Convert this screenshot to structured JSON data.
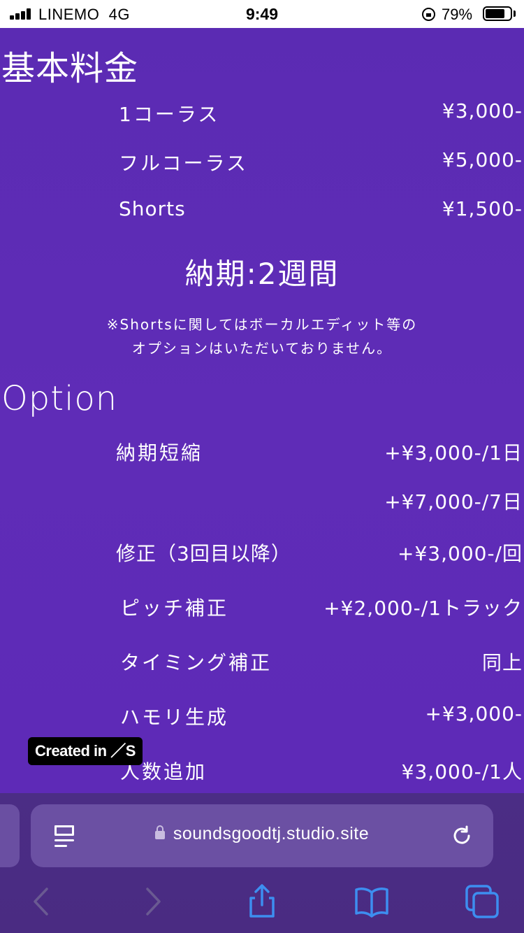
{
  "status_bar": {
    "carrier": "LINEMO",
    "network": "4G",
    "time": "9:49",
    "battery_pct": "79%",
    "battery_level": 0.79
  },
  "sections": {
    "basic": {
      "title": "基本料金",
      "items": [
        {
          "label": "1コーラス",
          "price": "¥3,000-"
        },
        {
          "label": "フルコーラス",
          "price": "¥5,000-"
        },
        {
          "label": "Shorts",
          "price": "¥1,500-"
        }
      ],
      "delivery": "納期:2週間",
      "note_line1": "※Shortsに関してはボーカルエディット等の",
      "note_line2": "オプションはいただいておりません。"
    },
    "option": {
      "title": "Option",
      "items": [
        {
          "label": "納期短縮",
          "price": "+¥3,000-/1日"
        },
        {
          "label": "",
          "price": "+¥7,000-/7日"
        },
        {
          "label": "修正（3回目以降）",
          "price": "+¥3,000-/回"
        },
        {
          "label": "ピッチ補正",
          "price": "+¥2,000-/1トラック"
        },
        {
          "label": "タイミング補正",
          "price": "同上"
        },
        {
          "label": "ハモリ生成",
          "price": "+¥3,000-"
        },
        {
          "label": "人数追加",
          "price": "¥3,000-/1人"
        }
      ]
    }
  },
  "badge": "Created in ／S",
  "browser": {
    "url": "soundsgoodtj.studio.site"
  },
  "colors": {
    "background": "#5a2bb4",
    "browser_chrome": "#4b2d85",
    "url_bar": "#6b50a3",
    "toolbar_icon": "#3d8ef0",
    "toolbar_icon_disabled": "#6a5a92"
  },
  "icons": [
    "signal-icon",
    "lock-rotation-icon",
    "battery-icon",
    "reader-icon",
    "lock-icon",
    "reload-icon",
    "back-icon",
    "forward-icon",
    "share-icon",
    "bookmarks-icon",
    "tabs-icon"
  ]
}
